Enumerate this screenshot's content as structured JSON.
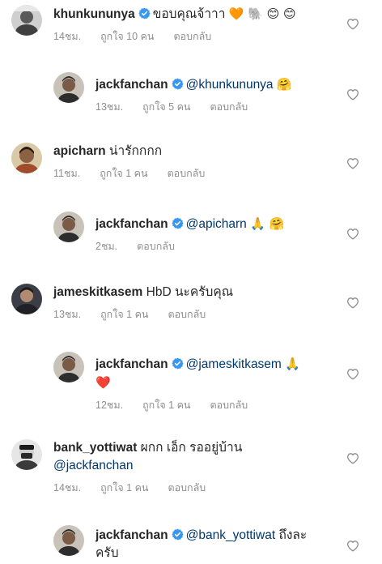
{
  "comments": [
    {
      "username": "khunkununya",
      "verified": true,
      "text": "ขอบคุณจ้าาา",
      "emoji": "🧡 🐘 😊 😊",
      "time": "14ชม.",
      "likes": "ถูกใจ 10 คน",
      "reply_label": "ตอบกลับ"
    },
    {
      "username": "jackfanchan",
      "verified": true,
      "mention": "@khunkununya",
      "emoji": "🤗",
      "time": "13ชม.",
      "likes": "ถูกใจ 5 คน",
      "reply_label": "ตอบกลับ"
    },
    {
      "username": "apicharn",
      "verified": false,
      "text": "น่ารักกกก",
      "time": "11ชม.",
      "likes": "ถูกใจ 1 คน",
      "reply_label": "ตอบกลับ"
    },
    {
      "username": "jackfanchan",
      "verified": true,
      "mention": "@apicharn",
      "emoji": "🙏 🤗",
      "time": "2ชม.",
      "reply_label": "ตอบกลับ"
    },
    {
      "username": "jameskitkasem",
      "verified": false,
      "text": "HbD นะครับคุณ",
      "time": "13ชม.",
      "likes": "ถูกใจ 1 คน",
      "reply_label": "ตอบกลับ"
    },
    {
      "username": "jackfanchan",
      "verified": true,
      "mention": "@jameskitkasem",
      "emoji": "🙏",
      "emoji2": "❤️",
      "time": "12ชม.",
      "likes": "ถูกใจ 1 คน",
      "reply_label": "ตอบกลับ"
    },
    {
      "username": "bank_yottiwat",
      "verified": false,
      "text": "ผกก เอ็ก รออยู่บ้าน",
      "mention": "@jackfanchan",
      "time": "14ชม.",
      "likes": "ถูกใจ 1 คน",
      "reply_label": "ตอบกลับ"
    },
    {
      "username": "jackfanchan",
      "verified": true,
      "mention": "@bank_yottiwat",
      "text": "ถึงละ",
      "text2": "ครับ"
    }
  ],
  "colors": {
    "username": "#262626",
    "mention": "#00376b",
    "meta": "#8e8e8e",
    "verified": "#3897f0"
  },
  "icons": {
    "like": "heart-outline-icon",
    "verified": "verified-badge-icon"
  }
}
